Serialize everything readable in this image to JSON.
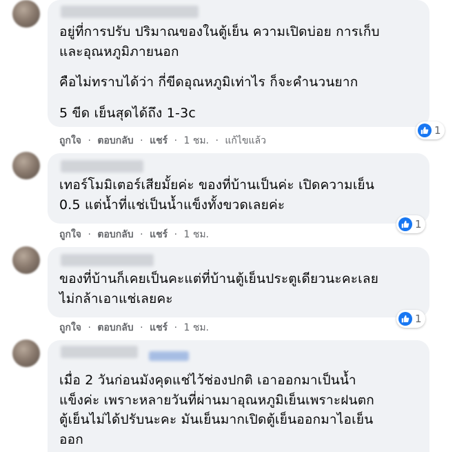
{
  "comments": [
    {
      "paragraphs": [
        "อยู่ที่การปรับ ปริมาณของในตู้เย็น ความเปิดบ่อย การเก็บ\nและอุณหภูมิภายนอก",
        "คือไม่ทราบได้ว่า กี่ขีดอุณหภูมิเท่าไร ก็จะคำนวนยาก",
        "5 ขีด เย็นสุดได้ถึง 1-3c"
      ],
      "likes": "1",
      "like": "ถูกใจ",
      "reply": "ตอบกลับ",
      "share": "แชร์",
      "time": "1 ชม.",
      "edited": "แก้ไขแล้ว"
    },
    {
      "paragraphs": [
        "เทอร์โมมิเตอร์เสียมั้ยค่ะ ของที่บ้านเป็นค่ะ เปิดความเย็น\n0.5 แต่น้ำที่แช่เป็นน้ำแข็งทั้งขวดเลยค่ะ"
      ],
      "likes": "1",
      "like": "ถูกใจ",
      "reply": "ตอบกลับ",
      "share": "แชร์",
      "time": "1 ชม."
    },
    {
      "paragraphs": [
        "ของที่บ้านก็เคยเป็นคะแต่ที่บ้านตู้เย็นประตูเดียวนะคะเลย\nไม่กล้าเอาแช่เลยคะ"
      ],
      "likes": "1",
      "like": "ถูกใจ",
      "reply": "ตอบกลับ",
      "share": "แชร์",
      "time": "1 ชม."
    },
    {
      "paragraphs": [
        "เมื่อ 2 วันก่อนมังคุดแช่ไว้ช่องปกติ เอาออกมาเป็นน้ำ\nแข็งค่ะ เพราะหลายวันที่ผ่านมาอุณหภูมิเย็นเพราะฝนตก\nตู้เย็นไม่ได้ปรับนะคะ มันเย็นมากเปิดตู้เย็นออกมาไอเย็น\nออก"
      ]
    }
  ],
  "separator": "·",
  "colors": {
    "bubble": "#f0f2f5",
    "meta": "#65676b",
    "like": "#1877f2"
  }
}
